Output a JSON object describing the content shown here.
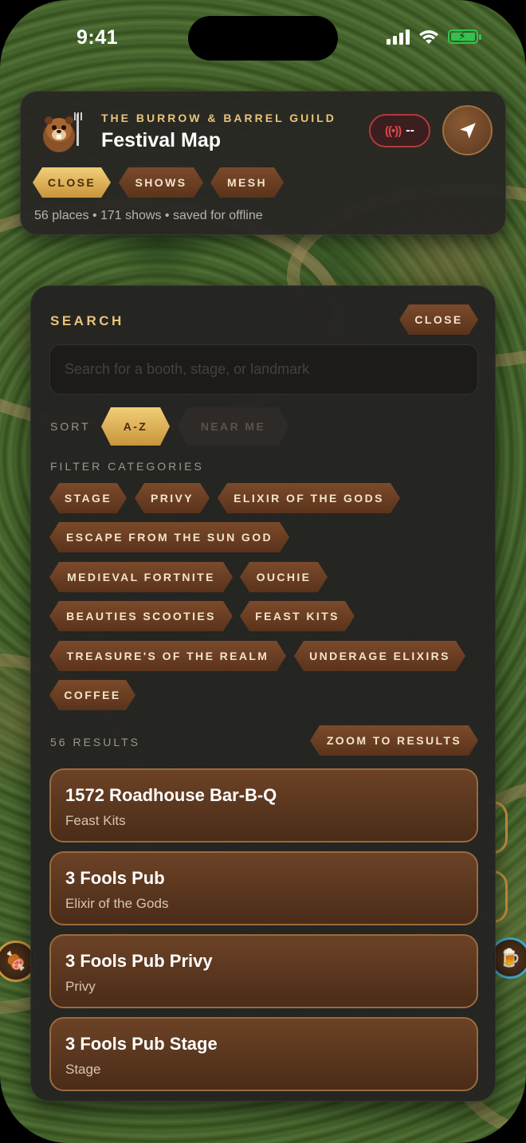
{
  "status_bar": {
    "time": "9:41"
  },
  "header": {
    "guild_name": "THE BURROW & BARREL GUILD",
    "title": "Festival Map",
    "mesh_status": "--",
    "tabs": [
      {
        "label": "CLOSE",
        "active": true
      },
      {
        "label": "SHOWS",
        "active": false
      },
      {
        "label": "MESH",
        "active": false
      }
    ],
    "stats": "56 places • 171 shows • saved for offline"
  },
  "search": {
    "heading": "SEARCH",
    "close_label": "CLOSE",
    "placeholder": "Search for a booth, stage, or landmark",
    "sort_label": "SORT",
    "sort_options": [
      {
        "label": "A-Z",
        "active": true
      },
      {
        "label": "NEAR ME",
        "active": false
      }
    ],
    "filter_label": "FILTER CATEGORIES",
    "categories": [
      "STAGE",
      "PRIVY",
      "ELIXIR OF THE GODS",
      "ESCAPE FROM THE SUN GOD",
      "MEDIEVAL FORTNITE",
      "OUCHIE",
      "BEAUTIES SCOOTIES",
      "FEAST KITS",
      "TREASURE'S OF THE REALM",
      "UNDERAGE ELIXIRS",
      "COFFEE"
    ],
    "results_count": "56 RESULTS",
    "zoom_label": "ZOOM TO RESULTS",
    "results": [
      {
        "name": "1572 Roadhouse Bar-B-Q",
        "category": "Feast Kits"
      },
      {
        "name": "3 Fools Pub",
        "category": "Elixir of the Gods"
      },
      {
        "name": "3 Fools Pub Privy",
        "category": "Privy"
      },
      {
        "name": "3 Fools Pub Stage",
        "category": "Stage"
      }
    ]
  },
  "colors": {
    "accent_gold": "#e8c57a",
    "chip_brown": "#6a3f24",
    "panel_bg": "#242322",
    "alert_red": "#b3393a"
  },
  "icons": {
    "mesh": "radio-waves-icon",
    "locate": "location-arrow-icon",
    "mascot": "beaver-mascot-icon"
  }
}
